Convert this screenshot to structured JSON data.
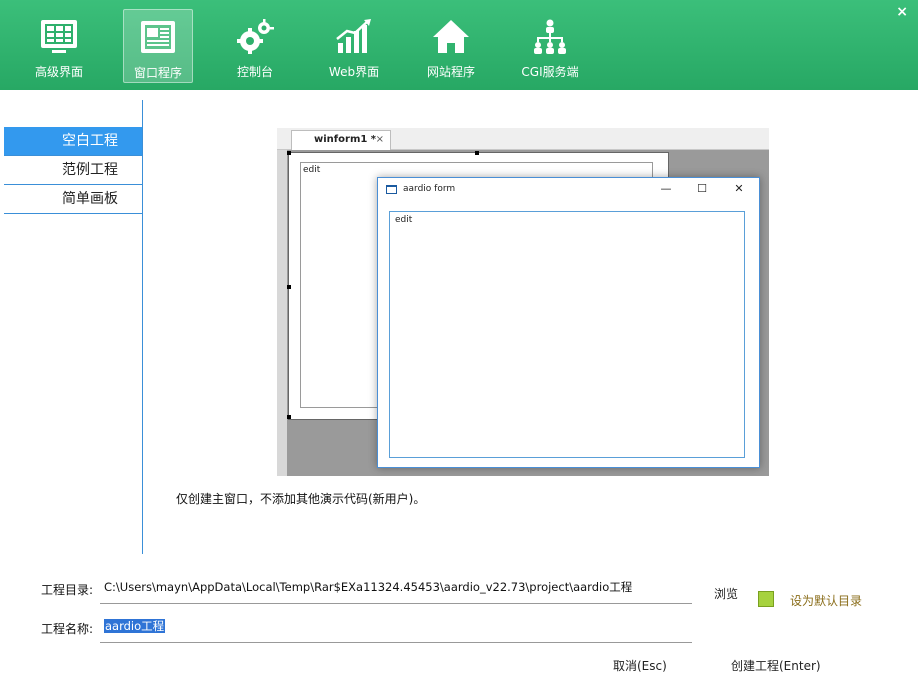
{
  "toolbar": {
    "tabs": [
      {
        "label": "高级界面",
        "icon": "advanced-ui-icon"
      },
      {
        "label": "窗口程序",
        "icon": "window-app-icon",
        "active": true
      },
      {
        "label": "控制台",
        "icon": "console-gears-icon"
      },
      {
        "label": "Web界面",
        "icon": "web-ui-chart-icon"
      },
      {
        "label": "网站程序",
        "icon": "website-home-icon"
      },
      {
        "label": "CGI服务端",
        "icon": "cgi-server-icon"
      }
    ],
    "close_glyph": "×"
  },
  "sidebar": {
    "items": [
      {
        "label": "空白工程",
        "active": true
      },
      {
        "label": "范例工程"
      },
      {
        "label": "简单画板"
      }
    ]
  },
  "preview": {
    "tab_label": "winform1 *",
    "tab_close": "×",
    "designer_edit_text": "edit",
    "form_title": "aardio form",
    "form_minimize": "—",
    "form_maximize": "☐",
    "form_close": "✕",
    "form_edit_text": "edit"
  },
  "description": "仅创建主窗口，不添加其他演示代码(新用户)。",
  "form": {
    "dir_label": "工程目录:",
    "dir_value": "C:\\Users\\mayn\\AppData\\Local\\Temp\\Rar$EXa11324.45453\\aardio_v22.73\\project\\aardio工程",
    "browse_label": "浏览",
    "default_dir_label": "设为默认目录",
    "name_label": "工程名称:",
    "name_value": "aardio工程",
    "cancel_label": "取消(Esc)",
    "create_label": "创建工程(Enter)"
  },
  "colors": {
    "header": "#2eb06c",
    "accent": "#3399ee",
    "default_dir_text": "#8a6d1a",
    "checkbox": "#a6d23e"
  }
}
